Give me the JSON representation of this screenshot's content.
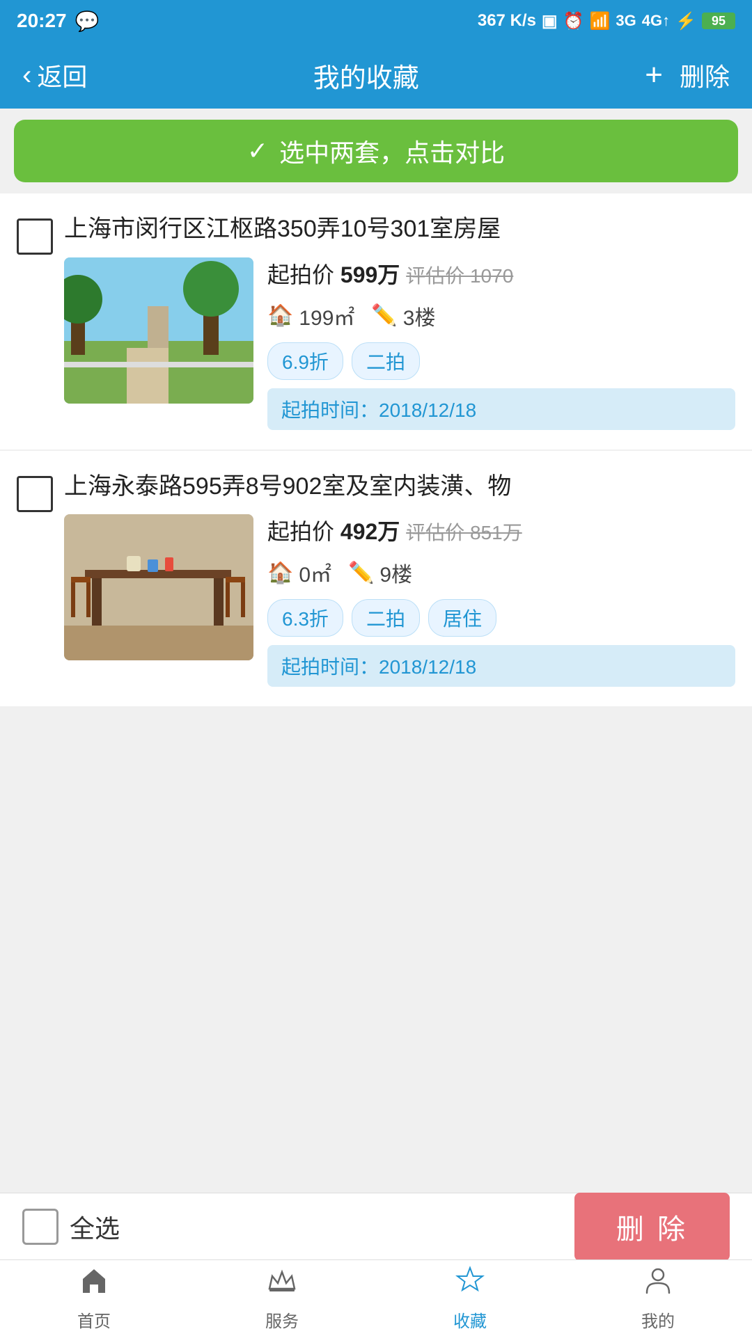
{
  "statusBar": {
    "time": "20:27",
    "speed": "367 K/s",
    "battery": "95"
  },
  "navBar": {
    "backLabel": "返回",
    "title": "我的收藏",
    "addLabel": "+",
    "deleteLabel": "删除"
  },
  "compareBanner": {
    "icon": "✓",
    "text": "选中两套，点击对比"
  },
  "properties": [
    {
      "id": "prop1",
      "title": "上海市闵行区江枢路350弄10号301室房屋",
      "startPrice": "起拍价 599万",
      "estimatePrice": "评估价 1070",
      "area": "199㎡",
      "floor": "3楼",
      "tags": [
        "6.9折",
        "二拍"
      ],
      "date": "起拍时间：2018/12/18"
    },
    {
      "id": "prop2",
      "title": "上海永泰路595弄8号902室及室内装潢、物",
      "startPrice": "起拍价 492万",
      "estimatePrice": "评估价 851万",
      "area": "0㎡",
      "floor": "9楼",
      "tags": [
        "6.3折",
        "二拍",
        "居住"
      ],
      "date": "起拍时间：2018/12/18"
    }
  ],
  "footerAction": {
    "selectAllLabel": "全选",
    "deleteBtnLabel": "删 除"
  },
  "tabBar": {
    "tabs": [
      {
        "id": "home",
        "label": "首页",
        "icon": "home"
      },
      {
        "id": "service",
        "label": "服务",
        "icon": "crown"
      },
      {
        "id": "favorites",
        "label": "收藏",
        "icon": "star",
        "active": true
      },
      {
        "id": "mine",
        "label": "我的",
        "icon": "person"
      }
    ]
  }
}
